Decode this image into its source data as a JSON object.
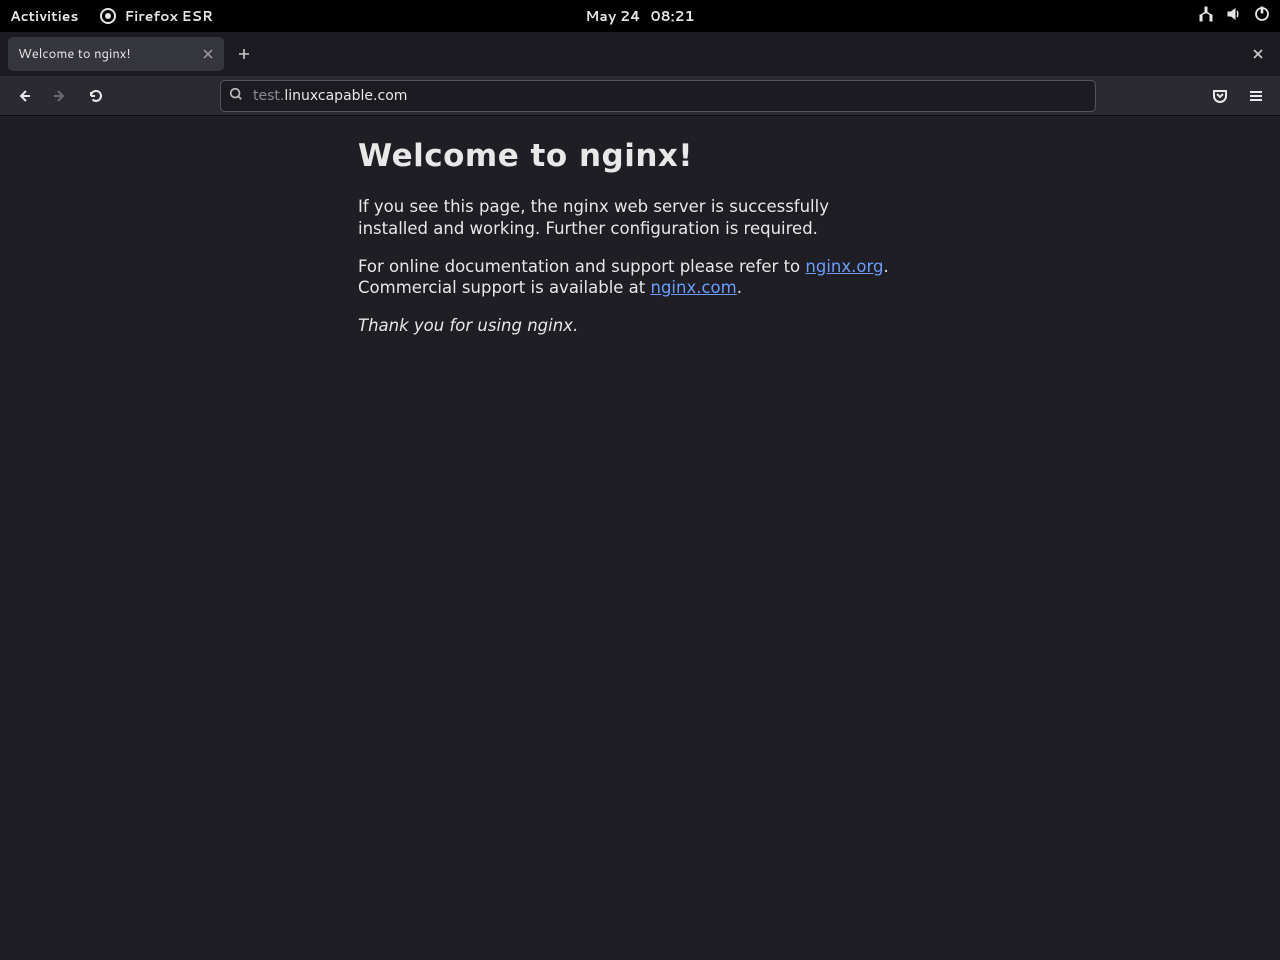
{
  "gnome": {
    "activities": "Activities",
    "app_name": "Firefox ESR",
    "date": "May 24",
    "time": "08:21"
  },
  "browser": {
    "tab_title": "Welcome to nginx!",
    "url_subdomain": "test.",
    "url_domain": "linuxcapable.com"
  },
  "page": {
    "heading": "Welcome to nginx!",
    "p1": "If you see this page, the nginx web server is successfully installed and working. Further configuration is required.",
    "p2a": "For online documentation and support please refer to ",
    "link1": "nginx.org",
    "p2b": ". Commercial support is available at ",
    "link2": "nginx.com",
    "p2c": ".",
    "p3": "Thank you for using nginx."
  }
}
